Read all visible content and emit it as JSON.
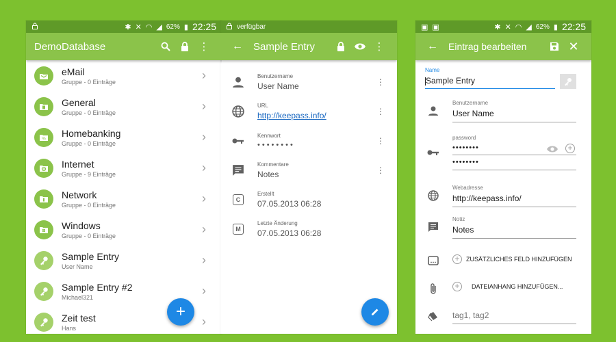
{
  "screen1": {
    "status": {
      "time": "22:25",
      "battery": "62%"
    },
    "title": "DemoDatabase",
    "items": [
      {
        "title": "eMail",
        "subtitle": "Gruppe - 0 Einträge",
        "kind": "group",
        "icon": "mail-icon"
      },
      {
        "title": "General",
        "subtitle": "Gruppe - 0 Einträge",
        "kind": "group",
        "icon": "document-icon"
      },
      {
        "title": "Homebanking",
        "subtitle": "Gruppe - 0 Einträge",
        "kind": "group",
        "icon": "percent-icon"
      },
      {
        "title": "Internet",
        "subtitle": "Gruppe - 9 Einträge",
        "kind": "group",
        "icon": "globe-icon"
      },
      {
        "title": "Network",
        "subtitle": "Gruppe - 0 Einträge",
        "kind": "group",
        "icon": "network-icon"
      },
      {
        "title": "Windows",
        "subtitle": "Gruppe - 0 Einträge",
        "kind": "group",
        "icon": "windows-icon"
      },
      {
        "title": "Sample Entry",
        "subtitle": "User Name",
        "kind": "entry",
        "icon": "key-icon"
      },
      {
        "title": "Sample Entry #2",
        "subtitle": "Michael321",
        "kind": "entry",
        "icon": "key-icon"
      },
      {
        "title": "Zeit test",
        "subtitle": "Hans",
        "kind": "entry",
        "icon": "key-icon"
      }
    ],
    "fab": "+"
  },
  "screen2": {
    "status": {
      "text": "verfügbar"
    },
    "title": "Sample Entry",
    "fields": [
      {
        "label": "Benutzername",
        "value": "User Name",
        "icon": "person-icon",
        "more": true
      },
      {
        "label": "URL",
        "value": "http://keepass.info/",
        "icon": "globe-icon",
        "more": true,
        "link": true
      },
      {
        "label": "Kennwort",
        "value": "••••••••",
        "icon": "key-icon",
        "more": true,
        "dots": true
      },
      {
        "label": "Kommentare",
        "value": "Notes",
        "icon": "comment-icon",
        "more": true
      },
      {
        "label": "Erstellt",
        "value": "07.05.2013 06:28",
        "icon": "created-icon",
        "badge": "C"
      },
      {
        "label": "Letzte Änderung",
        "value": "07.05.2013 06:28",
        "icon": "modified-icon",
        "badge": "M"
      }
    ]
  },
  "screen3": {
    "status": {
      "time": "22:25",
      "battery": "62%"
    },
    "title": "Eintrag bearbeiten",
    "name_label": "Name",
    "name_value": "Sample Entry",
    "username_label": "Benutzername",
    "username_value": "User Name",
    "password_label": "password",
    "password_value": "••••••••",
    "password_confirm": "••••••••",
    "web_label": "Webadresse",
    "web_value": "http://keepass.info/",
    "note_label": "Notiz",
    "note_value": "Notes",
    "add_field": "ZUSÄTZLICHES FELD HINZUFÜGEN",
    "add_attachment": "DATEIANHANG HINZUFÜGEN...",
    "tags_placeholder": "tag1, tag2"
  },
  "colors": {
    "primary": "#8bc34a",
    "status": "#5f9a28",
    "accent": "#1e88e5",
    "background": "#7dc12f"
  }
}
